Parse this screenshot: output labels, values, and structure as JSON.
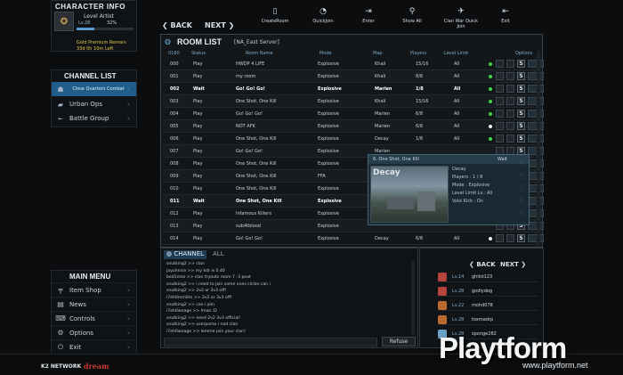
{
  "character_info": {
    "title": "CHARACTER INFO",
    "rank": "Level Artist",
    "level": "Lv.28",
    "exp_percent": "32%",
    "exp_fraction": 0.32,
    "gold": "Gold Premium Remain",
    "time_left": "33d 0h 10m Left"
  },
  "channel_list": {
    "title": "CHANNEL LIST",
    "items": [
      {
        "label": "Close Quarters Combat",
        "icon": "soldier-icon",
        "active": true
      },
      {
        "label": "Urban Ops",
        "icon": "tank-icon"
      },
      {
        "label": "Battle Group",
        "icon": "rifle-icon"
      }
    ]
  },
  "main_menu": {
    "title": "MAIN MENU",
    "items": [
      {
        "label": "Item Shop",
        "icon": "gun-icon"
      },
      {
        "label": "News",
        "icon": "news-icon"
      },
      {
        "label": "Controls",
        "icon": "controls-icon"
      },
      {
        "label": "Options",
        "icon": "gear-icon"
      },
      {
        "label": "Exit",
        "icon": "power-icon"
      }
    ]
  },
  "toolbar": {
    "back": "BACK",
    "next": "NEXT",
    "buttons": [
      {
        "label": "CreateRoom",
        "icon": "door-icon"
      },
      {
        "label": "QuickJoin",
        "icon": "stopwatch-icon"
      },
      {
        "label": "Enter",
        "icon": "enter-icon"
      },
      {
        "label": "Show All",
        "icon": "magnifier-icon"
      },
      {
        "label": "Clan War Quick Join",
        "icon": "plane-icon"
      },
      {
        "label": "Exit",
        "icon": "exit-icon"
      }
    ]
  },
  "room_list": {
    "title": "ROOM LIST",
    "server": "[NA_East Server]",
    "headers": [
      "0160",
      "Status",
      "Room Name",
      "Mode",
      "Map",
      "Players",
      "Level Limit",
      "Options"
    ],
    "rows": [
      [
        "000",
        "Play",
        "HWDP 4 LIFE",
        "Explosive",
        "Khali",
        "15/16",
        "All",
        "green"
      ],
      [
        "001",
        "Play",
        "my room",
        "Explosive",
        "Khali",
        "8/8",
        "All",
        "green"
      ],
      [
        "002",
        "Wait",
        "Go! Go! Go!",
        "Explosive",
        "Marien",
        "1/8",
        "All",
        "green"
      ],
      [
        "003",
        "Play",
        "One Shot, One Kill",
        "Explosive",
        "Khali",
        "15/16",
        "All",
        "green"
      ],
      [
        "004",
        "Play",
        "Go! Go! Go!",
        "Explosive",
        "Marien",
        "6/8",
        "All",
        "green"
      ],
      [
        "005",
        "Play",
        "NOT AFK",
        "Explosive",
        "Marien",
        "6/8",
        "All",
        "white"
      ],
      [
        "006",
        "Play",
        "One Shot, One Kill",
        "Explosive",
        "Decay",
        "1/8",
        "All",
        "green"
      ],
      [
        "007",
        "Play",
        "Go! Go! Go!",
        "Explosive",
        "Marien",
        "",
        "",
        ""
      ],
      [
        "008",
        "Play",
        "One Shot, One Kill",
        "Explosive",
        "",
        "",
        "",
        ""
      ],
      [
        "009",
        "Play",
        "One Shot, One Kill",
        "FFA",
        "",
        "",
        "",
        ""
      ],
      [
        "010",
        "Play",
        "One Shot, One Kill",
        "Explosive",
        "",
        "",
        "",
        ""
      ],
      [
        "011",
        "Wait",
        "One Shot, One Kill",
        "Explosive",
        "",
        "",
        "",
        ""
      ],
      [
        "012",
        "Play",
        "Infamous Killers",
        "Explosive",
        "",
        "",
        "",
        ""
      ],
      [
        "013",
        "Play",
        "sub4tblood",
        "Explosive",
        "",
        "",
        "",
        ""
      ],
      [
        "014",
        "Play",
        "Go! Go! Go!",
        "Explosive",
        "Decay",
        "6/8",
        "All",
        "white"
      ]
    ]
  },
  "popup": {
    "header": "6. One Shot, One Kill",
    "status": "Wait",
    "map_name": "Decay",
    "lines": [
      "Decay",
      "Players : 1 / 8",
      "Mode : Explosive",
      "Level Limit Lv.: All",
      "Vote Kick : On"
    ]
  },
  "chat": {
    "tab_channel": "CHANNEL",
    "tab_all": "ALL",
    "lines": [
      "snutking2 >> clan",
      "jayuhnice >> my kdr is 0.40",
      "bed1mez >> clan tryouts room 7 -3 peat",
      "snutking2 >> i need to join some ones clclan can i",
      "snutking2 >> 2v2 or 3v3 off!",
      "i7eh0mm0m >> 2v2 or 3v3 off!",
      "snutking2 >> can i join",
      "i7eh0wnage >> lmao :D",
      "snutking2 >> need 2v2 3v3 official!",
      "snutking2 >> userpomo i ned clan",
      "i7eh0wnage >> lemme join your clan!"
    ],
    "refuse": "Refuse"
  },
  "players": {
    "back": "BACK",
    "next": "NEXT",
    "list": [
      {
        "level": "Lv.14",
        "name": "ghilst123",
        "color": "#b5453c"
      },
      {
        "level": "Lv.28",
        "name": "godlydog",
        "color": "#b5453c"
      },
      {
        "level": "Lv.22",
        "name": "mohd078",
        "color": "#b86a2f"
      },
      {
        "level": "Lv.28",
        "name": "toxmadrp",
        "color": "#b86a2f"
      },
      {
        "level": "Lv.28",
        "name": "sponge282",
        "color": "#6aa0c8"
      }
    ]
  },
  "footer": {
    "k2": "K2 NETWORK",
    "dream": "dream"
  },
  "watermark": {
    "brand": "Playtform",
    "url": "www.playtform.net"
  },
  "colors": {
    "accent": "#1f5e8a",
    "status_green": "#3fd44a",
    "status_white": "#f2f2f2"
  }
}
